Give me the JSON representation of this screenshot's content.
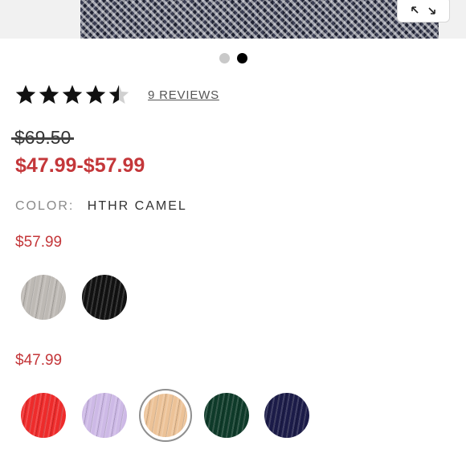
{
  "gallery": {
    "dots_count": 2,
    "active_dot": 1
  },
  "rating": {
    "value": 4.5,
    "max": 5,
    "reviews_label": "9 REVIEWS"
  },
  "price": {
    "original": "$69.50",
    "sale_range": "$47.99-$57.99"
  },
  "color": {
    "label": "COLOR:",
    "selected": "HTHR CAMEL"
  },
  "price_tiers": [
    {
      "price": "$57.99",
      "swatches": [
        {
          "name": "heather-grey",
          "hex": "#bdb9b4"
        },
        {
          "name": "black",
          "hex": "#111111"
        }
      ]
    },
    {
      "price": "$47.99",
      "swatches": [
        {
          "name": "red",
          "hex": "#ee2b2b"
        },
        {
          "name": "lavender",
          "hex": "#cdb9e6"
        },
        {
          "name": "hthr-camel",
          "hex": "#ecc297",
          "selected": true
        },
        {
          "name": "dark-green",
          "hex": "#0e3a29"
        },
        {
          "name": "navy",
          "hex": "#1b1b48"
        }
      ]
    }
  ],
  "colors": {
    "sale_red": "#c4373a",
    "star": "#111111",
    "star_empty": "#d0d0d0"
  }
}
